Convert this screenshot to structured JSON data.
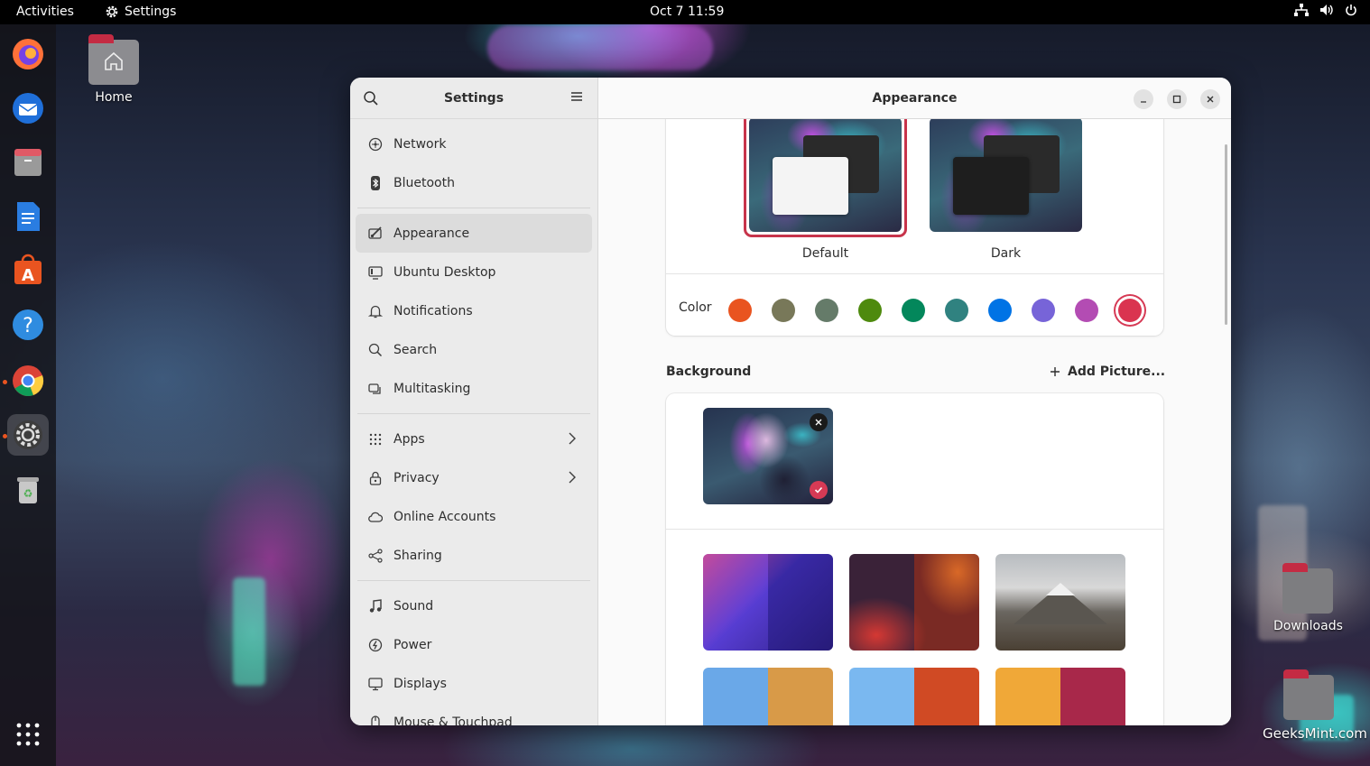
{
  "topbar": {
    "activities": "Activities",
    "app_name": "Settings",
    "clock": "Oct 7  11:59",
    "tray": [
      "network-icon",
      "volume-icon",
      "power-icon"
    ]
  },
  "dock": {
    "items": [
      "firefox-icon",
      "thunderbird-icon",
      "files-icon",
      "libreoffice-writer-icon",
      "app-center-icon",
      "help-icon",
      "chrome-icon",
      "settings-icon",
      "trash-icon",
      "show-apps-icon"
    ],
    "active": "settings-icon"
  },
  "desktop": {
    "home_label": "Home",
    "downloads_label": "Downloads",
    "watermark": "GeeksMint.com"
  },
  "sidebar": {
    "title": "Settings",
    "items": [
      {
        "label": "Network",
        "icon": "network-icon"
      },
      {
        "label": "Bluetooth",
        "icon": "bluetooth-icon"
      },
      {
        "label": "Appearance",
        "icon": "appearance-icon",
        "selected": true
      },
      {
        "label": "Ubuntu Desktop",
        "icon": "ubuntu-desktop-icon"
      },
      {
        "label": "Notifications",
        "icon": "bell-icon"
      },
      {
        "label": "Search",
        "icon": "search-icon"
      },
      {
        "label": "Multitasking",
        "icon": "multitasking-icon"
      },
      {
        "label": "Apps",
        "icon": "apps-grid-icon",
        "chevron": true
      },
      {
        "label": "Privacy",
        "icon": "lock-icon",
        "chevron": true
      },
      {
        "label": "Online Accounts",
        "icon": "cloud-icon"
      },
      {
        "label": "Sharing",
        "icon": "share-icon"
      },
      {
        "label": "Sound",
        "icon": "music-note-icon"
      },
      {
        "label": "Power",
        "icon": "power-icon"
      },
      {
        "label": "Displays",
        "icon": "display-icon"
      },
      {
        "label": "Mouse & Touchpad",
        "icon": "mouse-icon"
      }
    ]
  },
  "main": {
    "title": "Appearance",
    "style": {
      "options": [
        {
          "label": "Default",
          "selected": true
        },
        {
          "label": "Dark",
          "selected": false
        }
      ]
    },
    "color": {
      "label": "Color",
      "swatches": [
        "#e95420",
        "#787859",
        "#657b69",
        "#4e8a0e",
        "#03875b",
        "#308280",
        "#0073e5",
        "#7764d8",
        "#b34cb3",
        "#da3450"
      ],
      "selected": "#da3450"
    },
    "background": {
      "title": "Background",
      "add_picture": "Add Picture..."
    }
  },
  "colors": {
    "accent": "#da3450",
    "sidebar_bg": "#ebebeb",
    "window_bg": "#fafafa"
  }
}
